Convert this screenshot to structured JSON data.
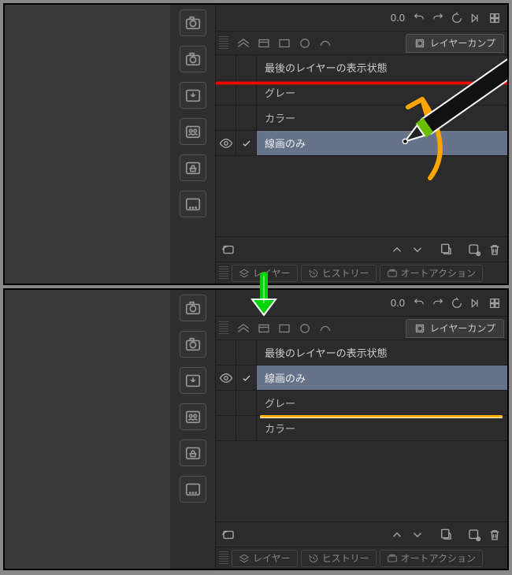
{
  "toolbar": {
    "value_label": "0.0"
  },
  "tab_layer_comp": "レイヤーカンプ",
  "header_row": "最後のレイヤーの表示状態",
  "rows_before": [
    {
      "label": "グレー",
      "visible": false,
      "checked": false,
      "selected": false
    },
    {
      "label": "カラー",
      "visible": false,
      "checked": false,
      "selected": false
    },
    {
      "label": "線画のみ",
      "visible": true,
      "checked": true,
      "selected": true
    }
  ],
  "rows_after": [
    {
      "label": "線画のみ",
      "visible": true,
      "checked": true,
      "selected": true
    },
    {
      "label": "グレー",
      "visible": false,
      "checked": false,
      "selected": false
    },
    {
      "label": "カラー",
      "visible": false,
      "checked": false,
      "selected": false
    }
  ],
  "bottom_tabs": {
    "layer": "レイヤー",
    "history": "ヒストリー",
    "autoaction": "オートアクション"
  },
  "annotations": {
    "redline": "drop-target-top",
    "orangeline": "moved-result",
    "greenarrow": "after-state-indicator",
    "orangearrow": "drag-direction"
  }
}
